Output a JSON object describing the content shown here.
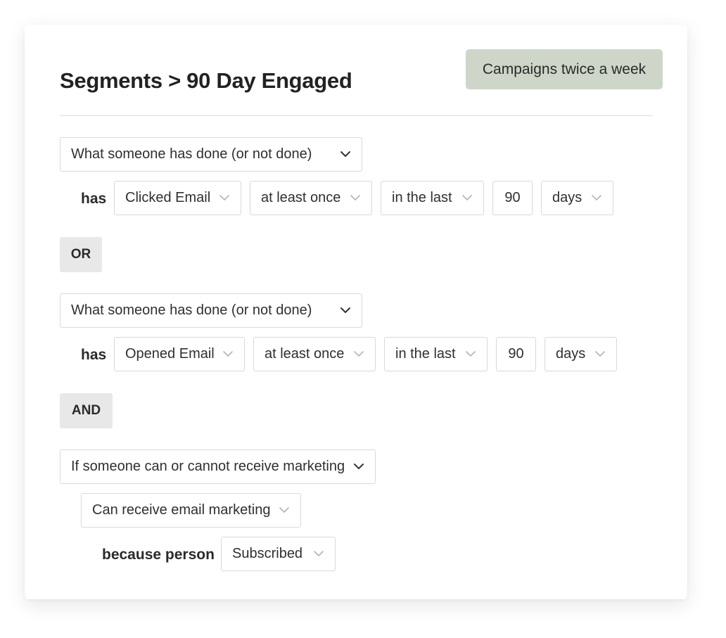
{
  "header": {
    "title": "Segments > 90 Day Engaged",
    "badge": "Campaigns twice a week"
  },
  "conditions": [
    {
      "type": "What someone has done (or not done)",
      "verb": "has",
      "event": "Clicked Email",
      "frequency": "at least once",
      "timeframe": "in the last",
      "count": "90",
      "unit": "days"
    },
    {
      "type": "What someone has done (or not done)",
      "verb": "has",
      "event": "Opened Email",
      "frequency": "at least once",
      "timeframe": "in the last",
      "count": "90",
      "unit": "days"
    },
    {
      "type": "If someone can or cannot receive marketing",
      "ability": "Can receive email marketing",
      "reason_label": "because person",
      "reason": "Subscribed"
    }
  ],
  "operators": [
    "OR",
    "AND"
  ],
  "icons": {
    "dropdown_dark": "chevron-down-icon",
    "dropdown_light": "chevron-down-light-icon"
  },
  "colors": {
    "badge_bg": "#cdd6c8",
    "operator_bg": "#e8e8e8"
  }
}
